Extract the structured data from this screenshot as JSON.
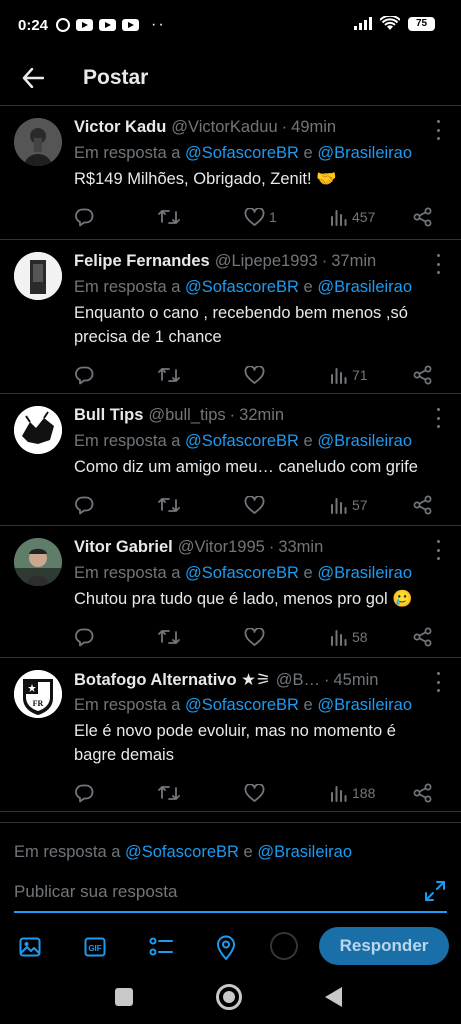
{
  "status_bar": {
    "time": "0:24",
    "battery": "75"
  },
  "header": {
    "title": "Postar"
  },
  "tweets": [
    {
      "name": "Victor Kadu",
      "handle": "@VictorKaduu",
      "sep": "·",
      "time": "49min",
      "reply_prefix": "Em resposta a",
      "mention1": "@SofascoreBR",
      "conj": "e",
      "mention2": "@Brasileirao",
      "text": "R$149 Milhões, Obrigado, Zenit! 🤝",
      "likes": "1",
      "views": "457",
      "avatar_color": "#3a3a3a"
    },
    {
      "name": "Felipe Fernandes",
      "handle": "@Lipepe1993",
      "sep": "·",
      "time": "37min",
      "reply_prefix": "Em resposta a",
      "mention1": "@SofascoreBR",
      "conj": "e",
      "mention2": "@Brasileirao",
      "text": "Enquanto o cano , recebendo bem menos ,só precisa de 1 chance",
      "likes": "",
      "views": "71",
      "avatar_color": "#f2f2f2"
    },
    {
      "name": "Bull Tips",
      "handle": "@bull_tips",
      "sep": "·",
      "time": "32min",
      "reply_prefix": "Em resposta a",
      "mention1": "@SofascoreBR",
      "conj": "e",
      "mention2": "@Brasileirao",
      "text": "Como diz um amigo meu… caneludo com grife",
      "likes": "",
      "views": "57",
      "avatar_color": "#ffffff"
    },
    {
      "name": "Vitor Gabriel",
      "handle": "@Vitor1995",
      "sep": "·",
      "time": "33min",
      "reply_prefix": "Em resposta a",
      "mention1": "@SofascoreBR",
      "conj": "e",
      "mention2": "@Brasileirao",
      "text": "Chutou pra tudo que é lado, menos pro gol 🥲",
      "likes": "",
      "views": "58",
      "avatar_color": "#4a6a55"
    },
    {
      "name": "Botafogo Alternativo ★⚞",
      "handle": "@B…",
      "sep": "·",
      "time": "45min",
      "reply_prefix": "Em resposta a",
      "mention1": "@SofascoreBR",
      "conj": "e",
      "mention2": "@Brasileirao",
      "text": "Ele é novo pode evoluir, mas no momento é bagre demais",
      "likes": "",
      "views": "188",
      "avatar_color": "#ffffff"
    }
  ],
  "composer": {
    "reply_prefix": "Em resposta a",
    "mention1": "@SofascoreBR",
    "conj": "e",
    "mention2": "@Brasileirao",
    "placeholder": "Publicar sua resposta",
    "reply_button": "Responder"
  },
  "colors": {
    "accent": "#1d9bf0",
    "muted": "#71767b",
    "text": "#e7e9ea",
    "border": "#2f3336"
  }
}
